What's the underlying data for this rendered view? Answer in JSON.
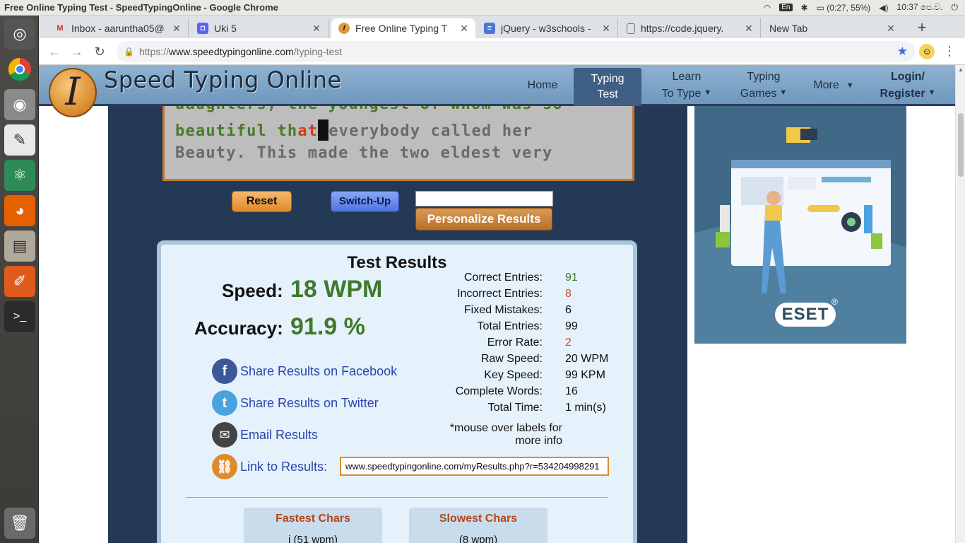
{
  "os": {
    "window_title": "Free Online Typing Test - SpeedTypingOnline - Google Chrome",
    "keyboard": "En",
    "battery": "(0:27, 55%)",
    "clock": "10:37 පෙ.ව."
  },
  "tabs": [
    {
      "label": "Inbox - aarunthа05@",
      "icon": "gmail-icon",
      "icon_char": "M"
    },
    {
      "label": "Uki 5",
      "icon": "discord-icon",
      "icon_char": "◘"
    },
    {
      "label": "Free Online Typing T",
      "icon": "speedtyping-icon",
      "icon_char": "I"
    },
    {
      "label": "jQuery - w3schools -",
      "icon": "docs-icon",
      "icon_char": "≡"
    },
    {
      "label": "https://code.jquery.",
      "icon": "page-icon",
      "icon_char": "▯"
    },
    {
      "label": "New Tab",
      "icon": "",
      "icon_char": ""
    }
  ],
  "omnibox": {
    "scheme": "https://",
    "host": "www.speedtypingonline.com",
    "path": "/typing-test"
  },
  "site": {
    "logo_letter": "I",
    "name": "Speed Typing Online",
    "nav": [
      {
        "line1": "Home",
        "line2": ""
      },
      {
        "line1": "Typing",
        "line2": "Test"
      },
      {
        "line1": "Learn",
        "line2": "To Type"
      },
      {
        "line1": "Typing",
        "line2": "Games"
      },
      {
        "line1": "More",
        "line2": ""
      },
      {
        "line1": "Login/",
        "line2": "Register"
      }
    ]
  },
  "typing_text": {
    "line1": "daughters, the youngest of whom was so",
    "line2_typed": "beautiful th",
    "line2_wrong": "at",
    "line2_rest": "everybody called her",
    "line3": "Beauty. This made the two eldest very"
  },
  "controls": {
    "reset": "Reset",
    "switch_up": "Switch-Up",
    "personalize": "Personalize Results",
    "name_value": ""
  },
  "results": {
    "title": "Test Results",
    "speed_label": "Speed:",
    "speed_value": "18 WPM",
    "accuracy_label": "Accuracy:",
    "accuracy_value": "91.9 %",
    "share_facebook": "Share Results on Facebook",
    "share_twitter": "Share Results on Twitter",
    "email": "Email Results",
    "link_label": "Link to Results:",
    "link_value": "www.speedtypingonline.com/myResults.php?r=534204998291",
    "note_line1": "*mouse over labels for",
    "note_line2": "more info",
    "stats": [
      {
        "label": "Correct Entries:",
        "value": "91",
        "color": "green"
      },
      {
        "label": "Incorrect Entries:",
        "value": "8",
        "color": "red"
      },
      {
        "label": "Fixed Mistakes:",
        "value": "6",
        "color": ""
      },
      {
        "label": "Total Entries:",
        "value": "99",
        "color": ""
      },
      {
        "label": "Error Rate:",
        "value": "2",
        "color": "red"
      },
      {
        "label": "Raw Speed:",
        "value": "20 WPM",
        "color": ""
      },
      {
        "label": "Key Speed:",
        "value": "99 KPM",
        "color": ""
      },
      {
        "label": "Complete Words:",
        "value": "16",
        "color": ""
      },
      {
        "label": "Total Time:",
        "value": "1 min(s)",
        "color": ""
      }
    ],
    "fastest_title": "Fastest Chars",
    "fastest_value": "i (51 wpm)",
    "slowest_title": "Slowest Chars",
    "slowest_value": "(8 wpm)"
  },
  "ad": {
    "brand": "ESET",
    "reg": "®"
  },
  "colors": {
    "header_blue": "#7ea6c8",
    "nav_active": "#3f5f85",
    "main_bg": "#243955",
    "accent_orange": "#e08a2a",
    "green_value": "#3f7a2a",
    "red_value": "#d1502a",
    "link_blue": "#2b44b0"
  }
}
